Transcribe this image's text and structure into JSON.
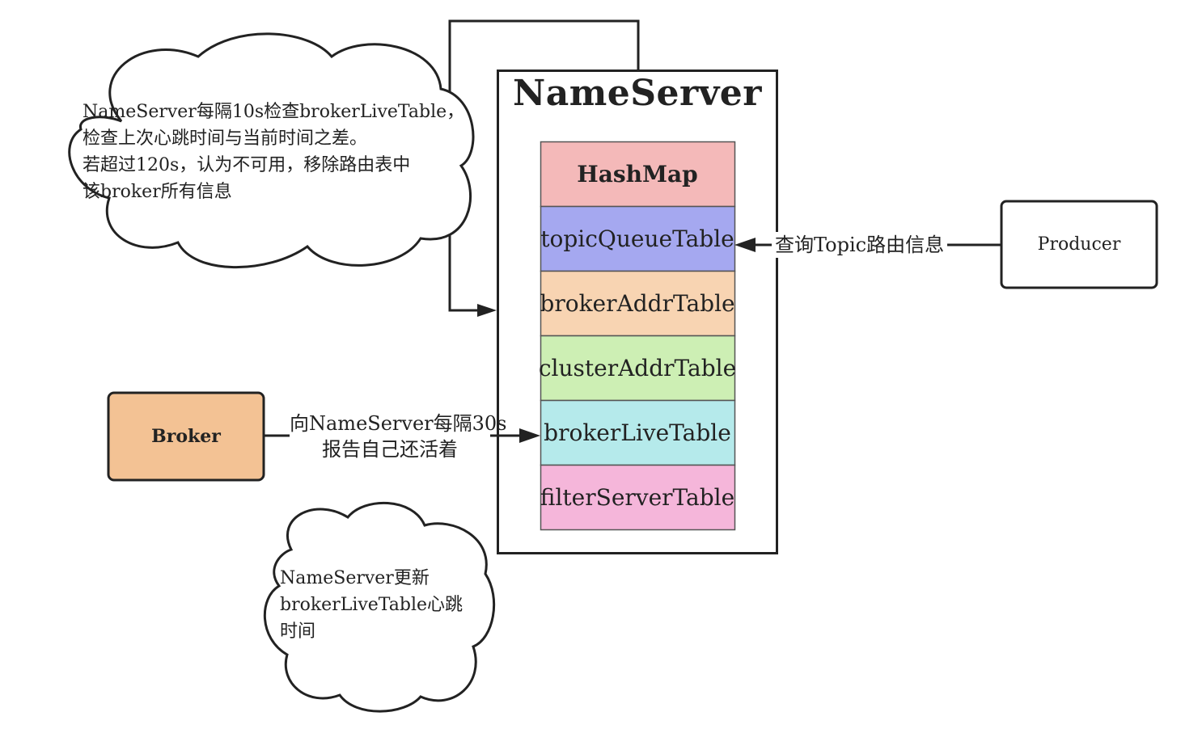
{
  "nameserver": {
    "title": "NameServer",
    "rows": [
      {
        "label": "HashMap",
        "color": "#f4b9b9"
      },
      {
        "label": "topicQueueTable",
        "color": "#a5a8f0"
      },
      {
        "label": "brokerAddrTable",
        "color": "#f8d4b2"
      },
      {
        "label": "clusterAddrTable",
        "color": "#cdefb4"
      },
      {
        "label": "brokerLiveTable",
        "color": "#b5eaeb"
      },
      {
        "label": "filterServerTable",
        "color": "#f5b6da"
      }
    ]
  },
  "broker": {
    "label": "Broker",
    "color": "#f3c294"
  },
  "producer": {
    "label": "Producer"
  },
  "edges": {
    "producer_query": "查询Topic路由信息",
    "broker_report_line1": "向NameServer每隔30s",
    "broker_report_line2": "报告自己还活着"
  },
  "clouds": {
    "check": [
      "NameServer每隔10s检查brokerLiveTable，",
      "检查上次心跳时间与当前时间之差。",
      "若超过120s，认为不可用，移除路由表中",
      "该broker所有信息"
    ],
    "update": [
      "NameServer更新",
      "brokerLiveTable心跳",
      "时间"
    ]
  }
}
